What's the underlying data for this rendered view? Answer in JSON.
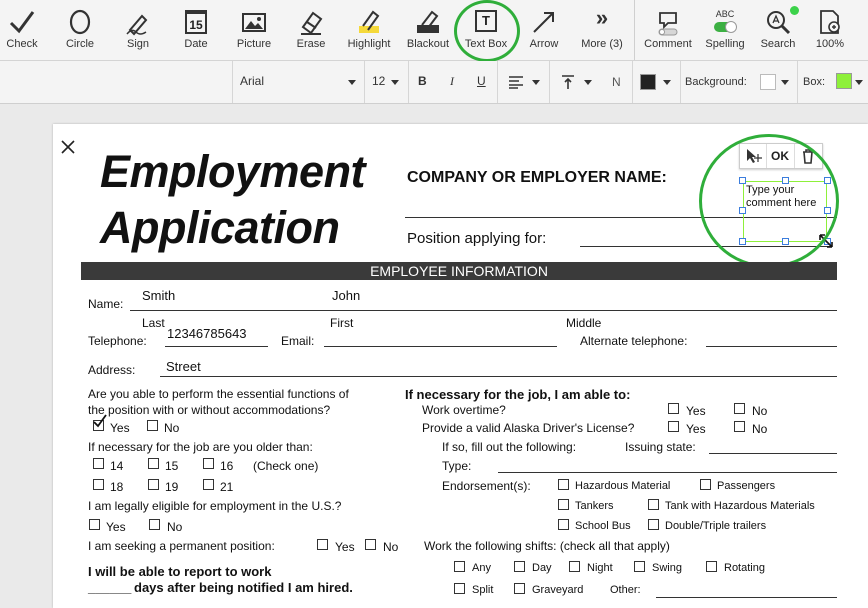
{
  "toolbar": {
    "tools": [
      {
        "label": "Check",
        "icon": "check-icon"
      },
      {
        "label": "Circle",
        "icon": "circle-icon"
      },
      {
        "label": "Sign",
        "icon": "sign-pen-icon"
      },
      {
        "label": "Date",
        "icon": "calendar-icon",
        "icon_text": "15"
      },
      {
        "label": "Picture",
        "icon": "picture-icon"
      },
      {
        "label": "Erase",
        "icon": "eraser-icon"
      },
      {
        "label": "Highlight",
        "icon": "highlighter-icon"
      },
      {
        "label": "Blackout",
        "icon": "blackout-icon"
      },
      {
        "label": "Text Box",
        "icon": "text-box-icon",
        "icon_text": "T"
      },
      {
        "label": "Arrow",
        "icon": "arrow-icon"
      },
      {
        "label": "More (3)",
        "icon": "chevrons-right-icon",
        "icon_text": "»"
      },
      {
        "label": "Comment",
        "icon": "comment-icon"
      },
      {
        "label": "Spelling",
        "icon": "spelling-toggle-icon",
        "icon_text": "ABC"
      },
      {
        "label": "Search",
        "icon": "search-icon"
      },
      {
        "label": "100%",
        "icon": "zoom-icon"
      }
    ]
  },
  "formatbar": {
    "font": "Arial",
    "size": "12",
    "bold": "B",
    "italic": "I",
    "underline": "U",
    "normal": "N",
    "background_label": "Background:",
    "box_label": "Box:",
    "text_color": "#222222",
    "box_color": "#8ef03a"
  },
  "textbox": {
    "ok": "OK",
    "placeholder": "Type your comment here"
  },
  "doc": {
    "title1": "Employment",
    "title2": "Application",
    "company_label": "COMPANY OR EMPLOYER NAME:",
    "position_label": "Position applying for:",
    "section": "EMPLOYEE INFORMATION",
    "name_label": "Name:",
    "last_value": "Smith",
    "first_value": "John",
    "last_label": "Last",
    "first_label": "First",
    "middle_label": "Middle",
    "telephone_label": "Telephone:",
    "telephone_value": "12346785643",
    "email_label": "Email:",
    "alt_tel_label": "Alternate telephone:",
    "address_label": "Address:",
    "address_value": "Street",
    "q1_line1": "Are you able to perform the essential functions of",
    "q1_line2": "the position with or without accommodations?",
    "yes": "Yes",
    "no": "No",
    "older_label": "If necessary for the job are you older than:",
    "age14": "14",
    "age15": "15",
    "age16": "16",
    "check_one": "(Check one)",
    "age18": "18",
    "age19": "19",
    "age21": "21",
    "eligible_label": "I am legally eligible for employment in the U.S.?",
    "permanent_label": "I am seeking a permanent position:",
    "report_line1": "I will be able to report to work",
    "report_line2_blank": "______",
    "report_line2": "days after being notified I am hired.",
    "able_header": "If necessary for the job, I am able to:",
    "overtime_label": "Work overtime?",
    "license_label": "Provide a valid Alaska Driver's License?",
    "if_so_label": "If so, fill out the following:",
    "issuing_label": "Issuing state:",
    "type_label": "Type:",
    "endorse_label": "Endorsement(s):",
    "endorse": [
      "Hazardous Material",
      "Passengers",
      "Tankers",
      "Tank with Hazardous Materials",
      "School Bus",
      "Double/Triple trailers"
    ],
    "shifts_label": "Work the following shifts: (check all that apply)",
    "shifts": [
      "Any",
      "Day",
      "Night",
      "Swing",
      "Rotating",
      "Split",
      "Graveyard"
    ],
    "other_label": "Other:"
  }
}
